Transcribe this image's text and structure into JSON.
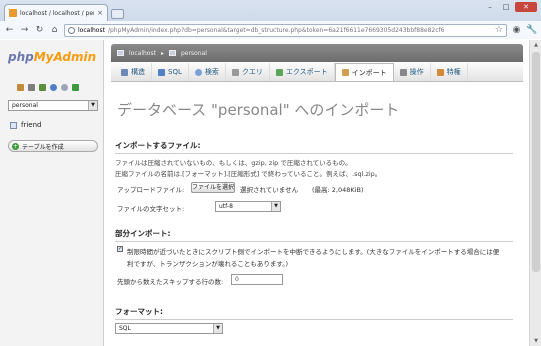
{
  "browser": {
    "tab_title": "localhost / localhost / perso",
    "tab_close": "×",
    "url_host": "localhost",
    "url_path": "/phpMyAdmin/index.php?db=personal&target=db_structure.php&token=6a21f6611e7669305d243bbf88e82cf6",
    "minimize": "–",
    "maximize": "□",
    "close": "✕"
  },
  "sidebar": {
    "logo_php": "php",
    "logo_myadmin": "MyAdmin",
    "db_selected": "personal",
    "tables": [
      {
        "name": "friend"
      }
    ],
    "create_table": "テーブルを作成"
  },
  "breadcrumb": {
    "server": "localhost",
    "db": "personal"
  },
  "tabs": [
    {
      "label": "構造",
      "color": "#6c8ab7"
    },
    {
      "label": "SQL",
      "color": "#4f7fc4"
    },
    {
      "label": "検索",
      "color": "#7aa0d8"
    },
    {
      "label": "クエリ",
      "color": "#999999"
    },
    {
      "label": "エクスポート",
      "color": "#5aa55a"
    },
    {
      "label": "インポート",
      "color": "#d0a050"
    },
    {
      "label": "操作",
      "color": "#888888"
    },
    {
      "label": "特権",
      "color": "#d58a3a"
    }
  ],
  "main": {
    "heading": "データベース \"personal\" へのインポート",
    "file_section": "インポートするファイル:",
    "file_desc1": "ファイルは圧縮されていないもの、もしくは、gzip, zip で圧縮されているもの。",
    "file_desc2": "圧縮ファイルの名前は.[フォーマット].[圧縮形式] で終わっていること。例えば、.sql.zip。",
    "upload_label": "アップロードファイル:",
    "file_button": "ファイルを選択",
    "no_file": "選択されていません",
    "max_size": "(最高: 2,048KiB)",
    "charset_label": "ファイルの文字セット:",
    "charset_value": "utf-8",
    "partial_section": "部分インポート:",
    "partial_desc1": "制限時間が近づいたときにスクリプト側でインポートを中断できるようにします。(大きなファイルをインポートする場合には便",
    "partial_desc2": "利ですが、トランザクションが壊れることもあります。)",
    "skip_label": "先頭から数えたスキップする行の数:",
    "skip_value": "0",
    "format_section": "フォーマット:",
    "format_value": "SQL"
  }
}
